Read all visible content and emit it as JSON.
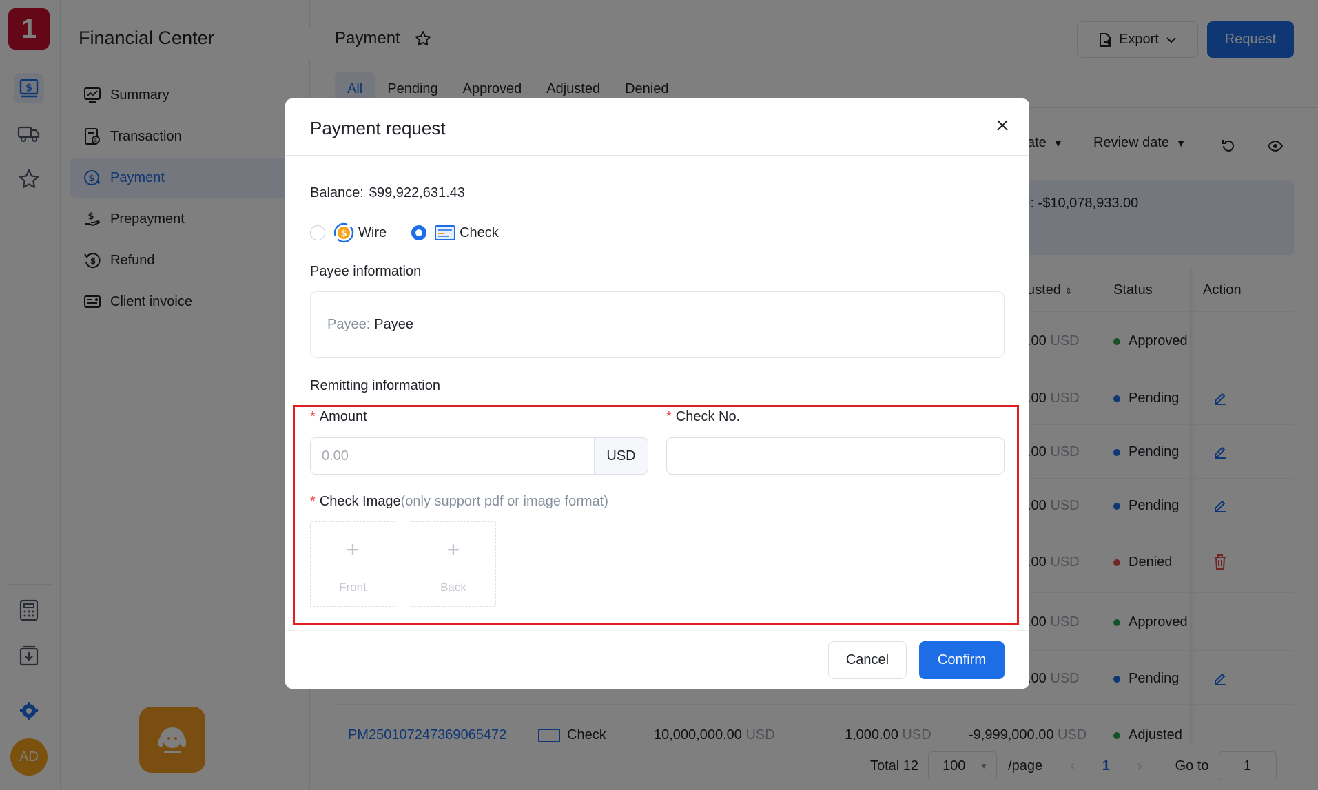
{
  "app": {
    "logo_text": "1",
    "avatar_text": "AD",
    "accent": "#1d6ee6",
    "brand": "#c8102e"
  },
  "sidebar": {
    "title": "Financial Center",
    "items": [
      {
        "label": "Summary",
        "icon": "chart-monitor-icon"
      },
      {
        "label": "Transaction",
        "icon": "transaction-icon"
      },
      {
        "label": "Payment",
        "icon": "dollar-payment-icon",
        "active": true
      },
      {
        "label": "Prepayment",
        "icon": "hand-dollar-icon"
      },
      {
        "label": "Refund",
        "icon": "refund-icon"
      },
      {
        "label": "Client invoice",
        "icon": "invoice-icon"
      }
    ]
  },
  "header": {
    "title": "Payment",
    "export_label": "Export",
    "request_label": "Request"
  },
  "tabs": [
    "All",
    "Pending",
    "Approved",
    "Adjusted",
    "Denied"
  ],
  "filters": {
    "date_partial": "ate",
    "review_date": "Review date"
  },
  "summary": {
    "partial_value": "l: -$10,078,933.00"
  },
  "table": {
    "headers": {
      "adjusted_partial": "usted",
      "status": "Status",
      "action": "Action"
    },
    "rows": [
      {
        "amount": ".00",
        "unit": "USD",
        "status": "Approved",
        "status_color": "#2aa44f",
        "action": ""
      },
      {
        "amount": ".00",
        "unit": "USD",
        "status": "Pending",
        "status_color": "#1d6ee6",
        "action": "edit-icon"
      },
      {
        "amount": ".00",
        "unit": "USD",
        "status": "Pending",
        "status_color": "#1d6ee6",
        "action": "edit-icon"
      },
      {
        "amount": ".00",
        "unit": "USD",
        "status": "Pending",
        "status_color": "#1d6ee6",
        "action": "edit-icon"
      },
      {
        "amount": ".00",
        "unit": "USD",
        "status": "Denied",
        "status_color": "#e34d4d",
        "action": "delete-icon"
      },
      {
        "amount": ".00",
        "unit": "USD",
        "status": "Approved",
        "status_color": "#2aa44f",
        "action": ""
      },
      {
        "amount": ".00",
        "unit": "USD",
        "status": "Pending",
        "status_color": "#1d6ee6",
        "action": "edit-icon"
      }
    ],
    "last_row": {
      "id": "PM250107247369065472",
      "method": "Check",
      "amount": "10,000,000.00",
      "fee": "1,000.00",
      "adjusted": "-9,999,000.00",
      "unit": "USD",
      "status": "Adjusted"
    }
  },
  "pager": {
    "total": "Total 12",
    "page_size": "100",
    "per_page": "/page",
    "current": "1",
    "goto_label": "Go to",
    "goto_value": "1"
  },
  "modal": {
    "title": "Payment request",
    "balance_label": "Balance:",
    "balance_value": "$99,922,631.43",
    "methods": [
      {
        "label": "Wire",
        "icon": "wire-dollar-icon",
        "checked": false
      },
      {
        "label": "Check",
        "icon": "check-card-icon",
        "checked": true
      }
    ],
    "payee_section": "Payee information",
    "payee_key": "Payee:",
    "payee_value": "Payee",
    "remit_section": "Remitting information",
    "amount_label": "Amount",
    "amount_placeholder": "0.00",
    "amount_suffix": "USD",
    "check_no_label": "Check No.",
    "check_no_value": "",
    "check_image_label": "Check Image",
    "check_image_hint": "(only support pdf or image format)",
    "upload_front": "Front",
    "upload_back": "Back",
    "cancel_label": "Cancel",
    "confirm_label": "Confirm",
    "required_mark": "*"
  }
}
